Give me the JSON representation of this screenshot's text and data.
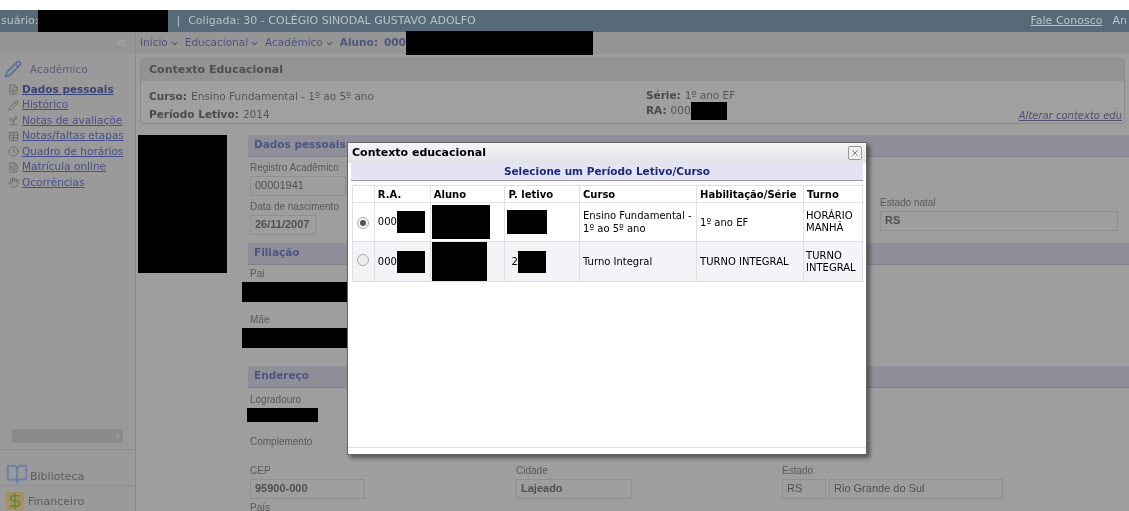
{
  "header": {
    "user_label": "suário:",
    "separator": "|",
    "school": "Coligada: 30 - COLÉGIO SINODAL GUSTAVO ADOLFO",
    "links": [
      "Fale Conosco",
      "An"
    ]
  },
  "breadcrumb": {
    "items": [
      "Início",
      "Educacional",
      "Acadêmico"
    ],
    "student_label": "Aluno:",
    "student_value": "000"
  },
  "sidebar": {
    "section": "Acadêmico",
    "items": [
      {
        "label": "Dados pessoais",
        "selected": true
      },
      {
        "label": "Histórico",
        "selected": false
      },
      {
        "label": "Notas de avaliaçõe",
        "selected": false
      },
      {
        "label": "Notas/faltas etapas",
        "selected": false
      },
      {
        "label": "Quadro de horários",
        "selected": false
      },
      {
        "label": "Matrícula online",
        "selected": false
      },
      {
        "label": "Ocorrências",
        "selected": false
      }
    ],
    "modules": [
      "Biblioteca",
      "Financeiro"
    ]
  },
  "context": {
    "title": "Contexto Educacional",
    "fields": [
      {
        "label": "Curso:",
        "value": "Ensino Fundamental - 1º ao 5º ano"
      },
      {
        "label": "Período Letivo:",
        "value": "2014"
      },
      {
        "label": "Série:",
        "value": "1º ano EF"
      },
      {
        "label": "RA:",
        "value": "000"
      }
    ],
    "link": "Alterar contexto edu"
  },
  "personal": {
    "title": "Dados pessoais",
    "fields": [
      {
        "label": "Registro Acadêmico",
        "value": "00001941"
      },
      {
        "label": "Data de nascimento",
        "value": "26/11/2007"
      },
      {
        "label": "Estado natal",
        "value": "RS"
      }
    ]
  },
  "filiacao": {
    "title": "Filiação",
    "fields": [
      "Pai",
      "Mãe"
    ]
  },
  "endereco": {
    "title": "Endereço",
    "fields": [
      {
        "label": "Logradouro"
      },
      {
        "label": "Complemento"
      },
      {
        "label": "CEP",
        "value": "95900-000"
      },
      {
        "label": "Cidade",
        "value": "Lajeado"
      },
      {
        "label": "Estado",
        "value": "RS",
        "value_2": "Rio Grande do Sul"
      },
      {
        "label": "País"
      }
    ]
  },
  "modal": {
    "title": "Contexto educacional",
    "heading": "Selecione um Período Letivo/Curso",
    "columns": [
      "R.A.",
      "Aluno",
      "P. letivo",
      "Curso",
      "Habilitação/Série",
      "Turno"
    ],
    "rows": [
      {
        "selected": true,
        "ra": "000",
        "curso": "Ensino Fundamental - 1º ao 5º ano",
        "serie": "1º ano EF",
        "turno": "HORÁRIO MANHÃ"
      },
      {
        "selected": false,
        "ra": "000",
        "p_letivo": "2",
        "curso": "Turno Integral",
        "serie": "TURNO INTEGRAL",
        "turno": "TURNO INTEGRAL"
      }
    ]
  }
}
